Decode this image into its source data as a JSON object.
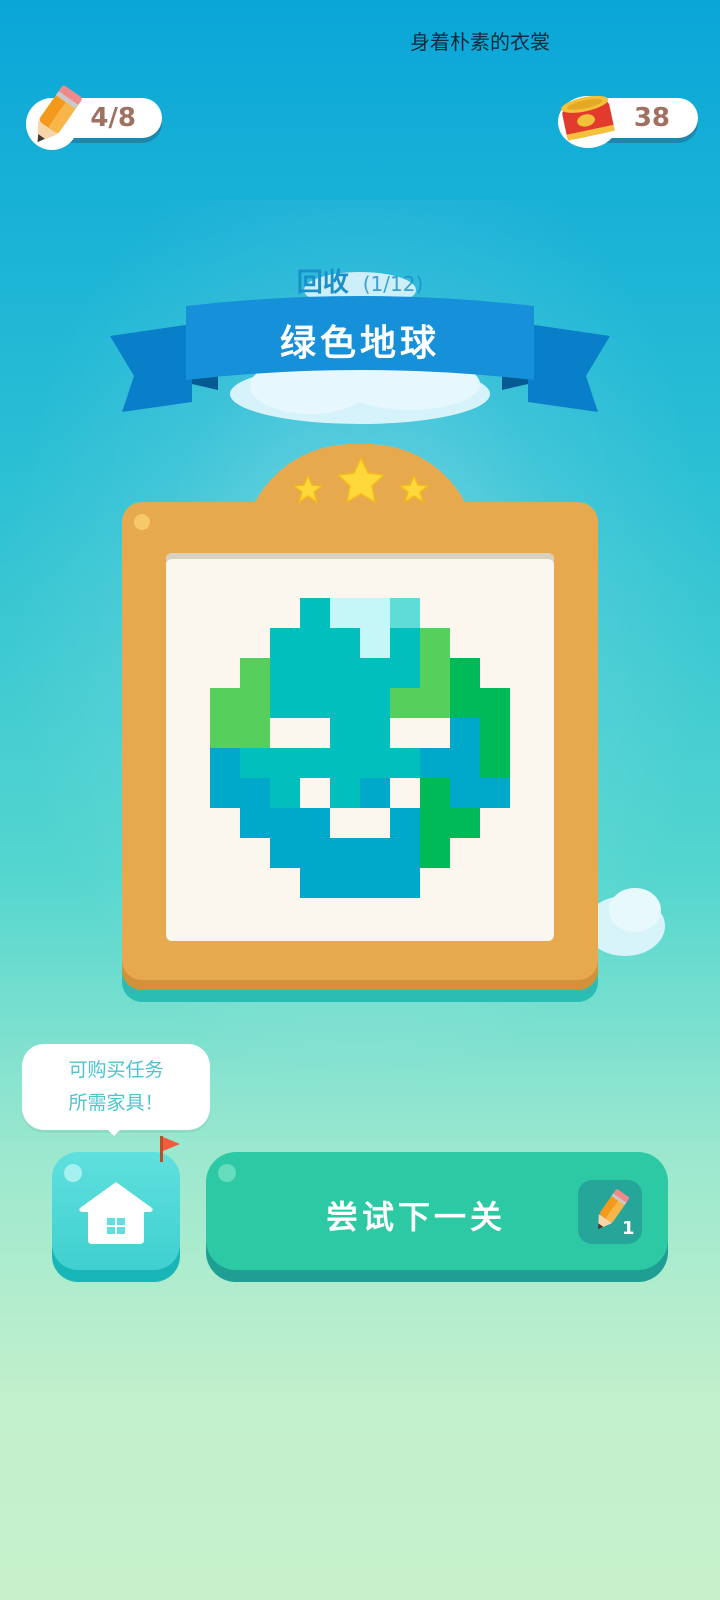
{
  "header": {
    "top_title": "身着朴素的衣裳",
    "pencils": "4/8",
    "coins": "38"
  },
  "level": {
    "category": "回收",
    "progress": "(1/12)",
    "title": "绿色地球",
    "stars": 3
  },
  "tip_bubble": {
    "line1": "可购买任务",
    "line2": "所需家具！"
  },
  "buttons": {
    "home": "home-icon",
    "next_label": "尝试下一关",
    "next_cost": "1"
  },
  "colors": {
    "accent_teal": "#2dc9a4",
    "frame": "#e7a94e",
    "ribbon": "#1690d8"
  }
}
